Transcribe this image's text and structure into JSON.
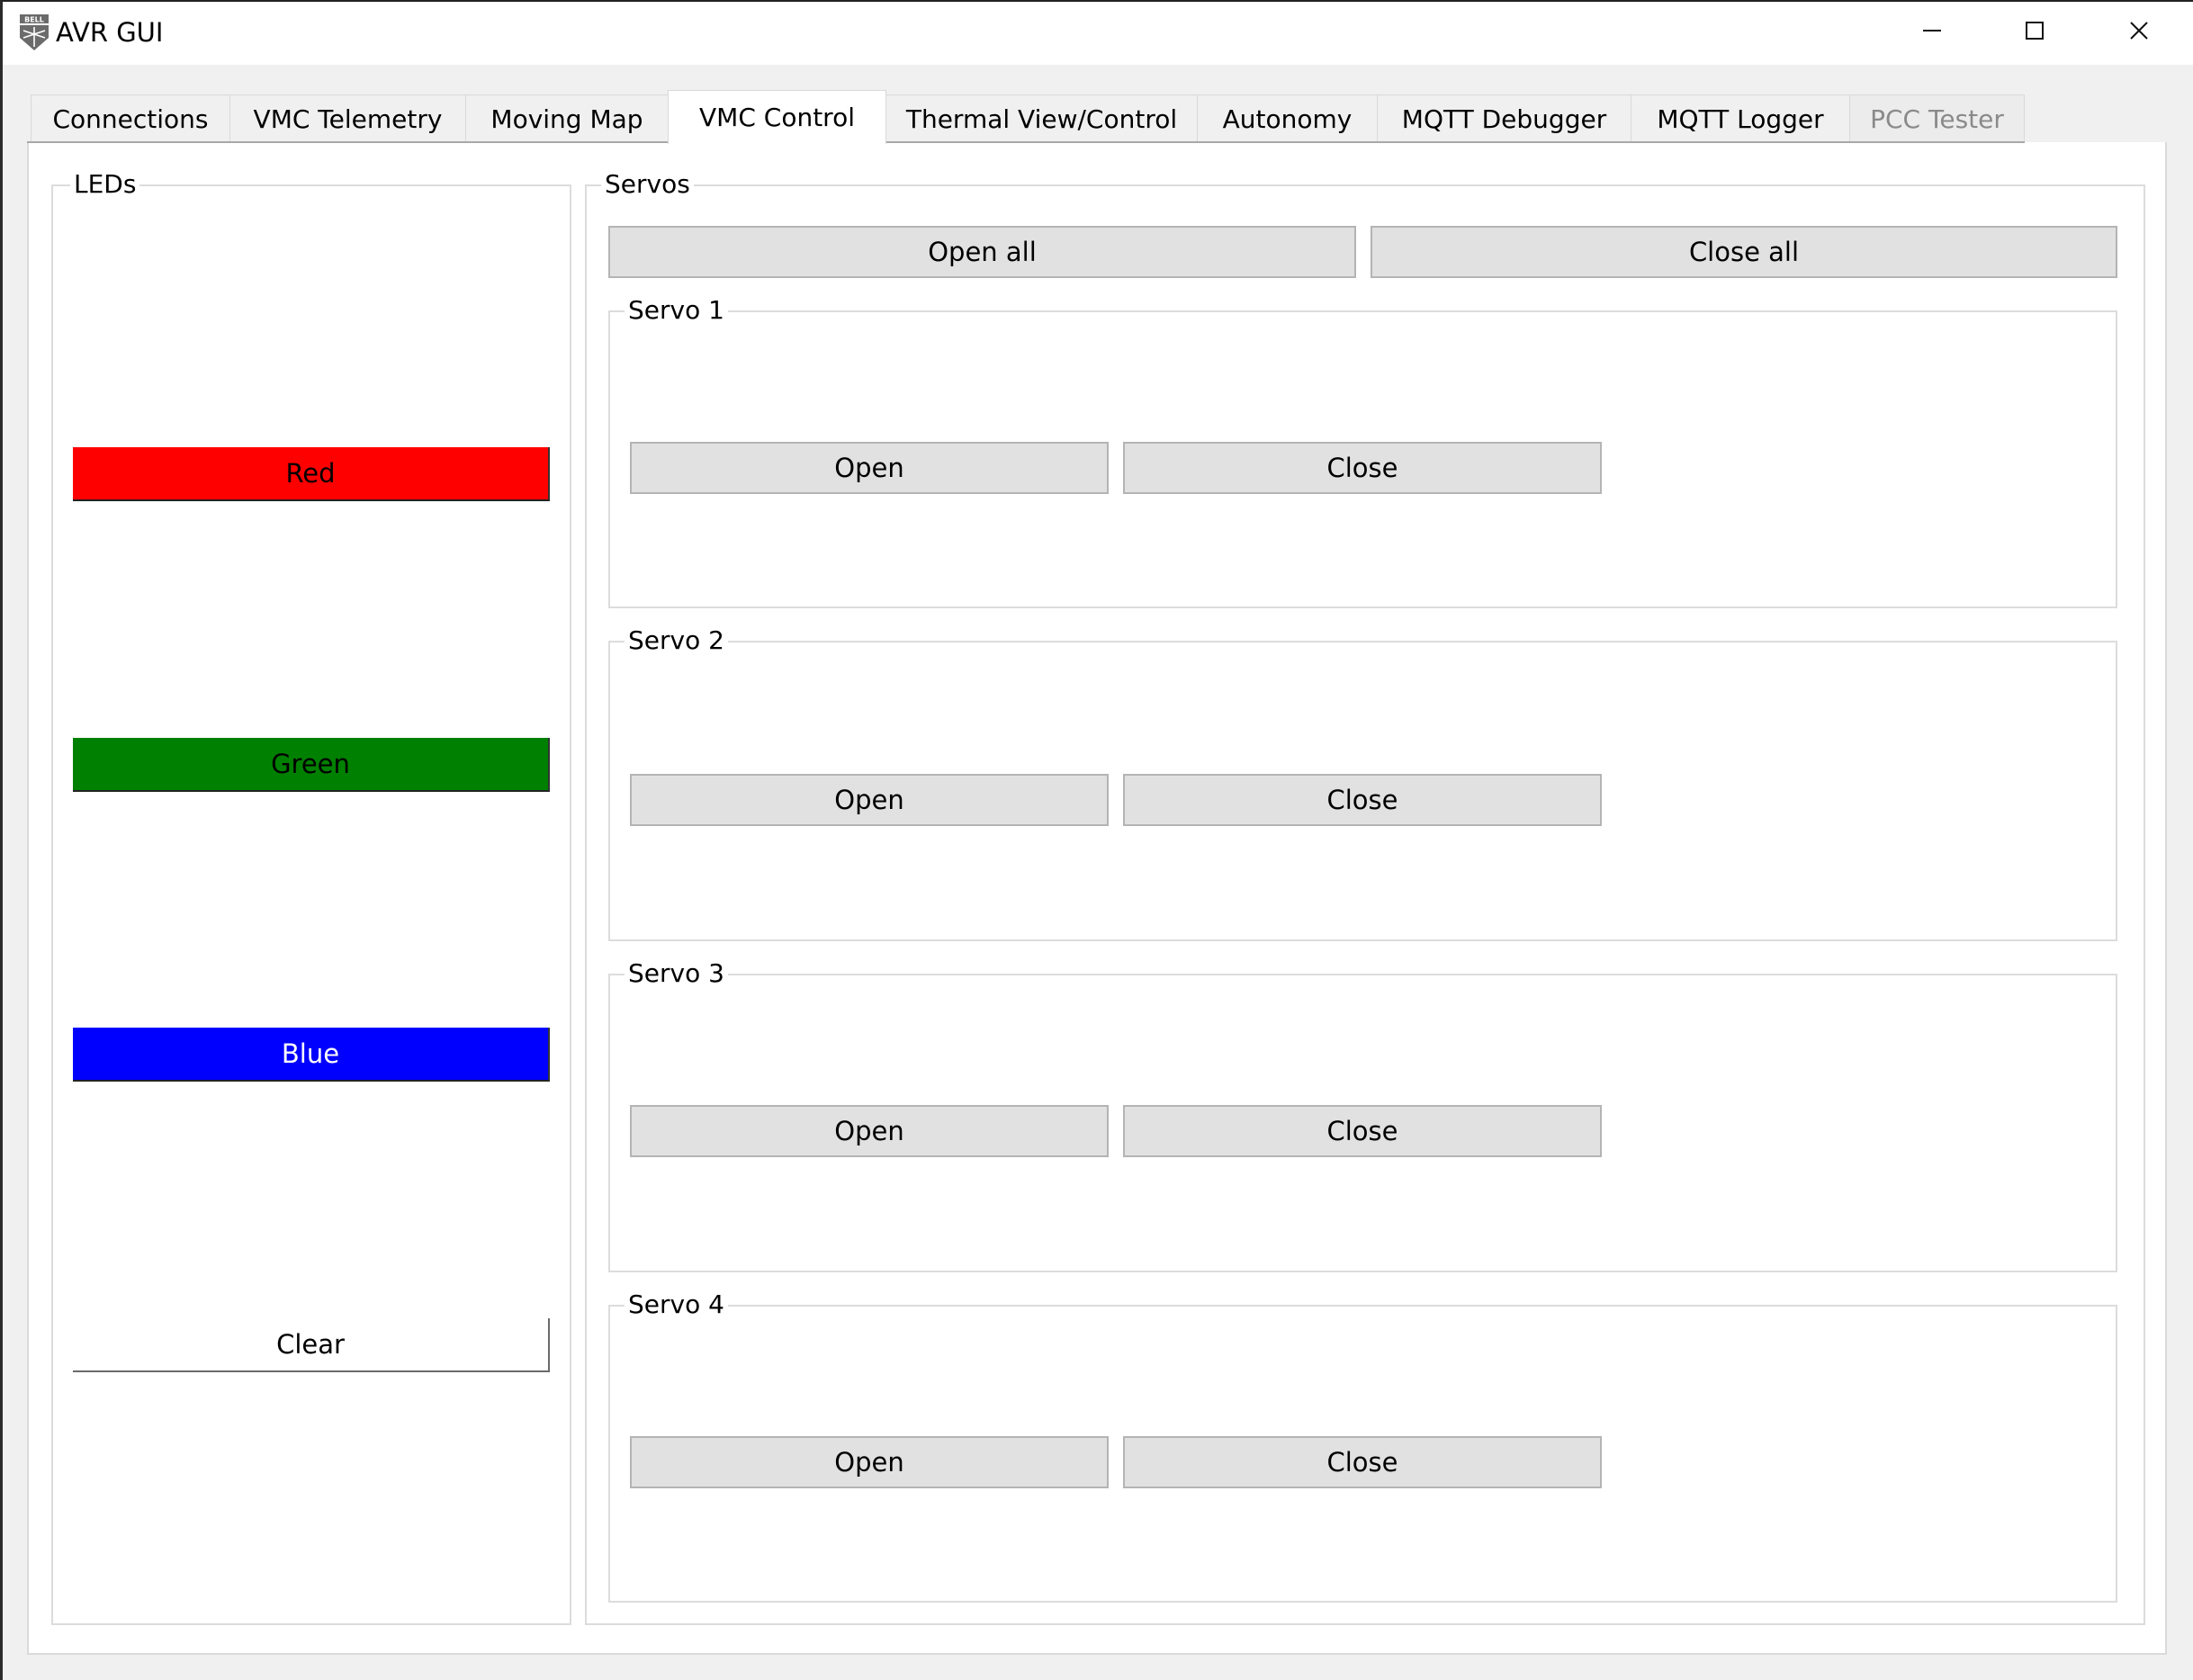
{
  "window": {
    "title": "AVR GUI",
    "icon": "bell-logo-icon",
    "controls": [
      "minimize-icon",
      "maximize-icon",
      "close-icon"
    ]
  },
  "tabs": [
    {
      "label": "Connections",
      "state": "normal"
    },
    {
      "label": "VMC Telemetry",
      "state": "normal"
    },
    {
      "label": "Moving Map",
      "state": "normal"
    },
    {
      "label": "VMC Control",
      "state": "active"
    },
    {
      "label": "Thermal View/Control",
      "state": "normal"
    },
    {
      "label": "Autonomy",
      "state": "normal"
    },
    {
      "label": "MQTT Debugger",
      "state": "normal"
    },
    {
      "label": "MQTT Logger",
      "state": "normal"
    },
    {
      "label": "PCC Tester",
      "state": "disabled"
    }
  ],
  "leds": {
    "title": "LEDs",
    "buttons": [
      {
        "label": "Red",
        "bg": "#ff0000",
        "fg": "#000000"
      },
      {
        "label": "Green",
        "bg": "#008000",
        "fg": "#000000"
      },
      {
        "label": "Blue",
        "bg": "#0000ff",
        "fg": "#ffffff"
      },
      {
        "label": "Clear",
        "bg": "#ffffff",
        "fg": "#000000"
      }
    ]
  },
  "servos": {
    "title": "Servos",
    "open_all": "Open all",
    "close_all": "Close all",
    "items": [
      {
        "title": "Servo 1",
        "open": "Open",
        "close": "Close"
      },
      {
        "title": "Servo 2",
        "open": "Open",
        "close": "Close"
      },
      {
        "title": "Servo 3",
        "open": "Open",
        "close": "Close"
      },
      {
        "title": "Servo 4",
        "open": "Open",
        "close": "Close"
      }
    ]
  }
}
